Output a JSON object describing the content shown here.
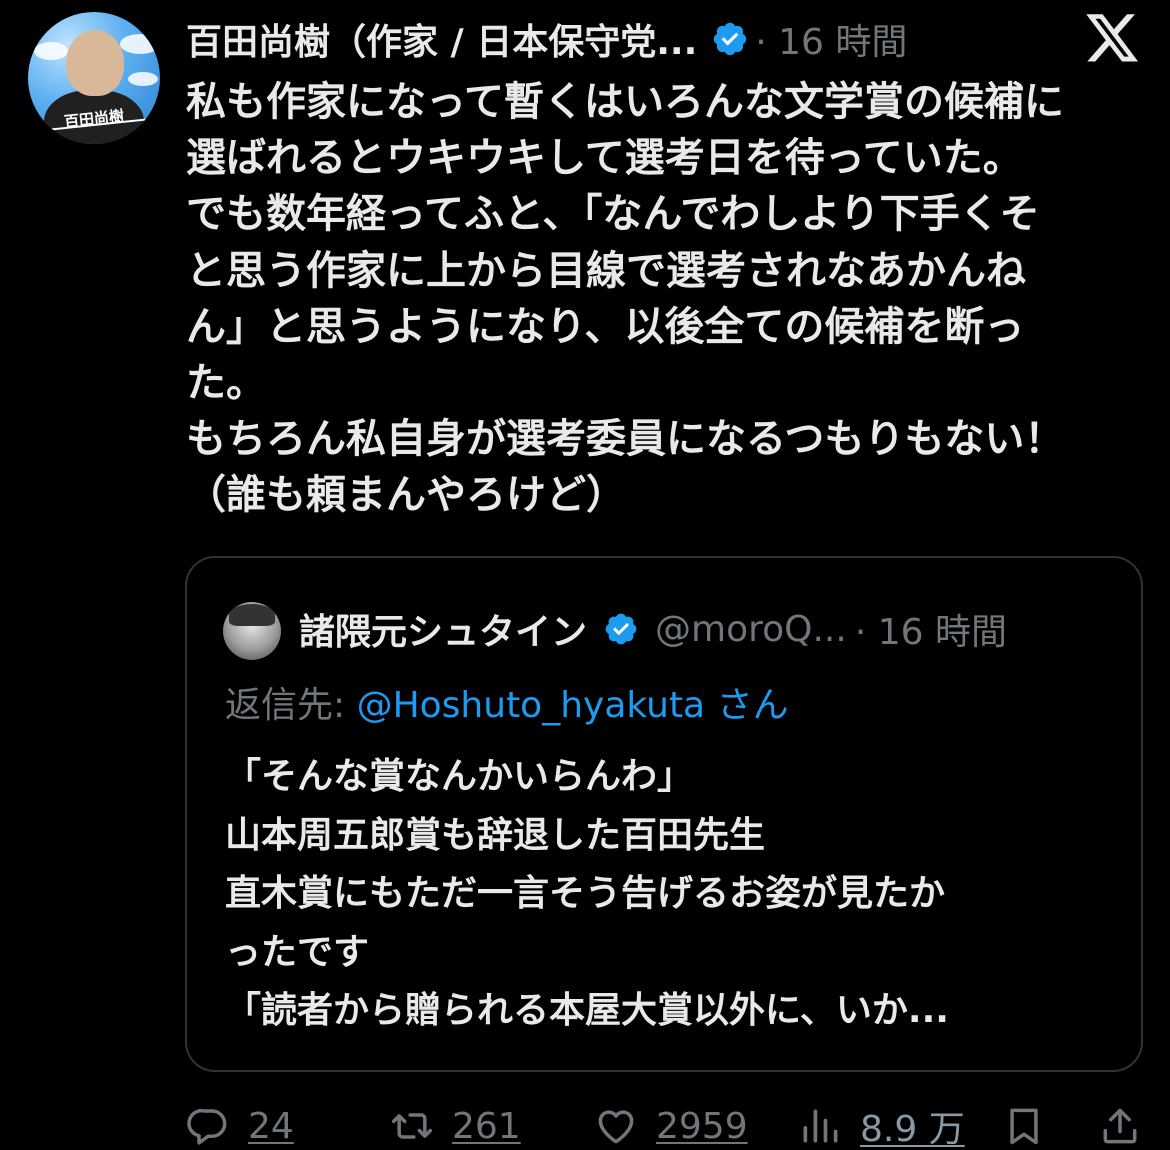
{
  "tweet": {
    "author_name": "百田尚樹（作家 / 日本保守党...",
    "time": "· 16 時間",
    "avatar_signature": "百田尚樹",
    "body_lines": [
      "私も作家になって暫くはいろんな文学賞の候補に",
      "選ばれるとウキウキして選考日を待っていた。",
      "でも数年経ってふと、「なんでわしより下手くそ",
      "と思う作家に上から目線で選考されなあかんね",
      "ん」と思うようになり、以後全ての候補を断っ",
      "た。",
      "もちろん私自身が選考委員になるつもりもない！",
      "（誰も頼まんやろけど）"
    ]
  },
  "quote": {
    "author_name": "諸隈元シュタイン",
    "handle": "@moroQ...",
    "time": "· 16 時間",
    "reply_label": "返信先: ",
    "reply_handle": "@Hoshuto_hyakuta",
    "reply_suffix": " さん",
    "body_lines": [
      "「そんな賞なんかいらんわ」",
      "山本周五郎賞も辞退した百田先生",
      "直木賞にもただ一言そう告げるお姿が見たか",
      "ったです",
      "「読者から贈られる本屋大賞以外に、いか..."
    ]
  },
  "actions": {
    "reply_count": "24",
    "retweet_count": "261",
    "like_count": "2959",
    "views_count": "8.9 万"
  },
  "icons": {
    "verified": "verified-badge-icon",
    "brand": "x-logo-icon",
    "reply": "reply-icon",
    "retweet": "retweet-icon",
    "like": "heart-icon",
    "views": "views-icon",
    "bookmark": "bookmark-icon",
    "share": "share-icon"
  },
  "colors": {
    "background": "#000000",
    "text": "#e7e9ea",
    "muted": "#71767b",
    "link": "#1d9bf0",
    "border": "#2f3336"
  }
}
